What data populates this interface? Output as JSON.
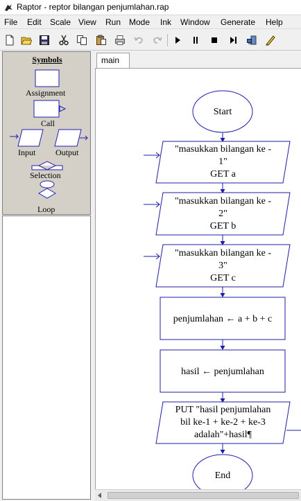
{
  "window": {
    "title": "Raptor - reptor bilangan penjumlahan.rap"
  },
  "menu": [
    "File",
    "Edit",
    "Scale",
    "View",
    "Run",
    "Mode",
    "Ink",
    "Window",
    "Generate",
    "Help"
  ],
  "toolbar": {
    "buttons": [
      "new-icon",
      "open-icon",
      "save-icon",
      "cut-icon",
      "copy-icon",
      "paste-icon",
      "print-icon",
      "undo-icon",
      "redo-icon",
      "play-icon",
      "pause-icon",
      "stop-icon",
      "step-icon",
      "test-server-icon",
      "pen-icon"
    ]
  },
  "symbols": {
    "title": "Symbols",
    "assignment": "Assignment",
    "call": "Call",
    "input": "Input",
    "output": "Output",
    "selection": "Selection",
    "loop": "Loop"
  },
  "tabs": [
    {
      "label": "main"
    }
  ],
  "flowchart": {
    "start": "Start",
    "input1_line1": "\"masukkan bilangan ke -",
    "input1_line2": "1\"",
    "input1_line3": "GET a",
    "input2_line1": "\"masukkan bilangan ke -",
    "input2_line2": "2\"",
    "input2_line3": "GET b",
    "input3_line1": "\"masukkan bilangan ke -",
    "input3_line2": "3\"",
    "input3_line3": "GET c",
    "assign1": "penjumlahan ← a + b + c",
    "assign2": "hasil ← penjumlahan",
    "output_line1": "PUT \"hasil penjumlahan",
    "output_line2": "bil ke-1 + ke-2 + ke-3",
    "output_line3": "adalah\"+hasil¶",
    "end": "End"
  },
  "colors": {
    "flow_stroke": "#1c1ca8",
    "panel_bg": "#d4d0c8"
  }
}
